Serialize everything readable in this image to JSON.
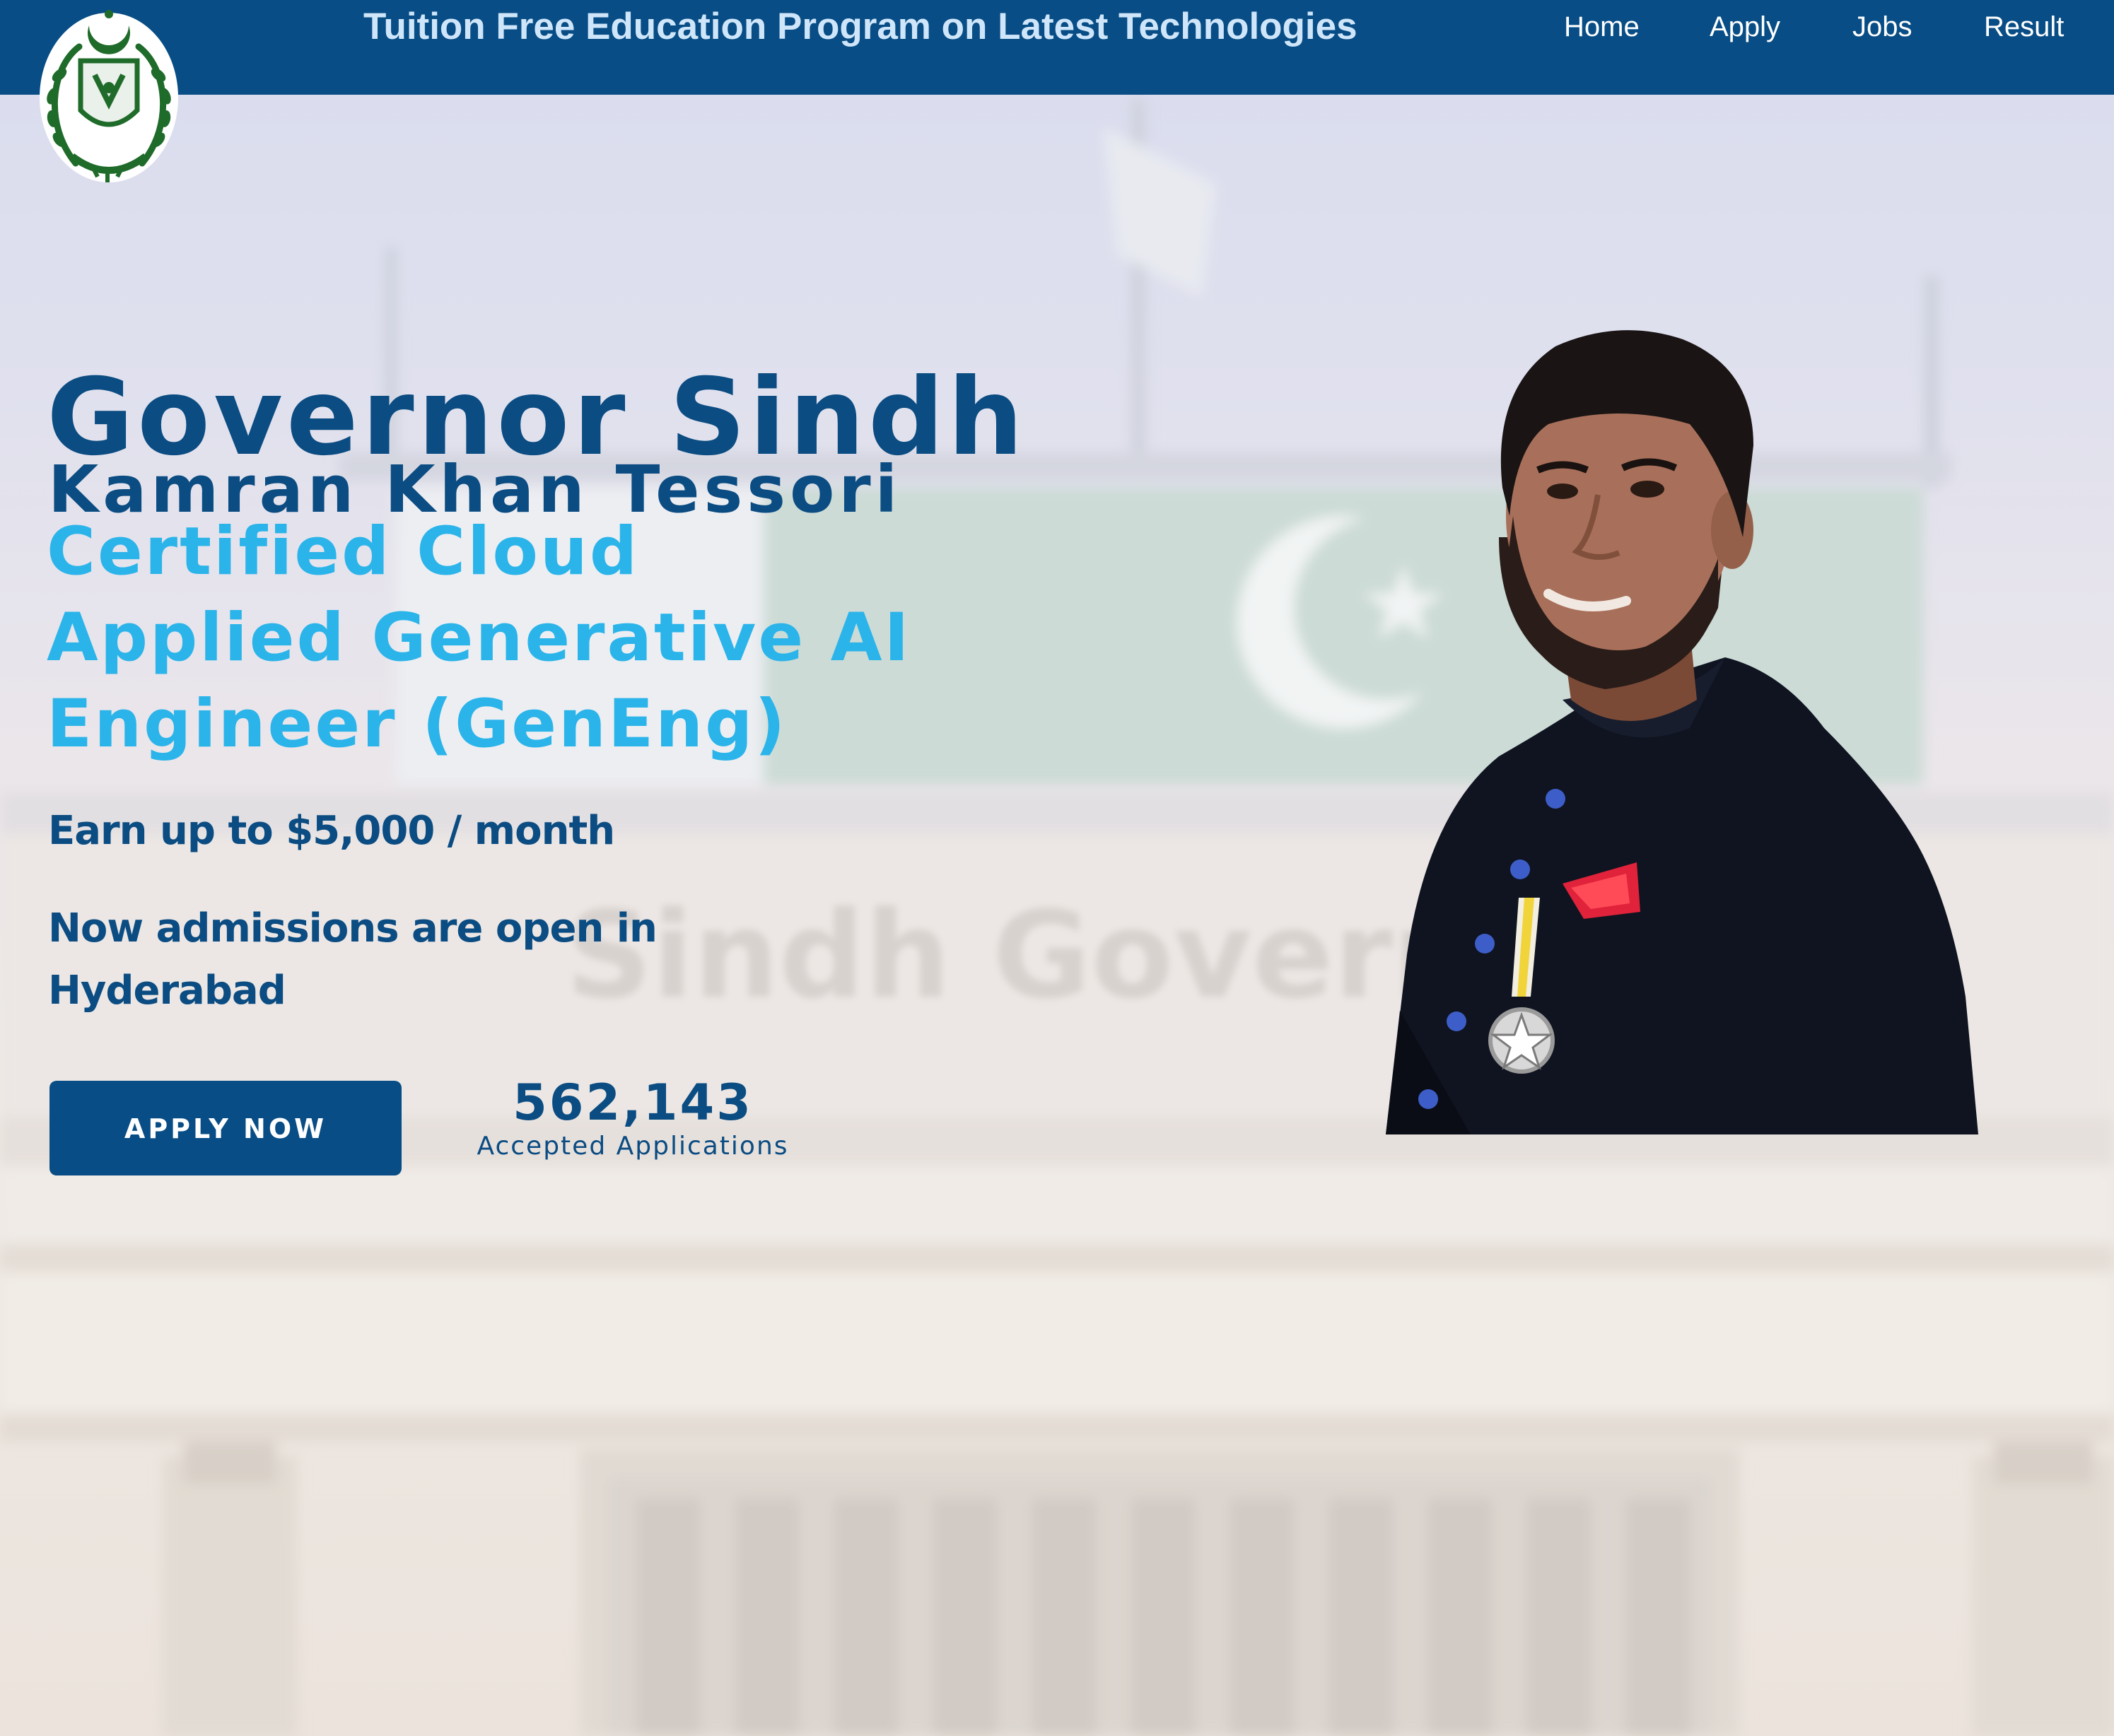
{
  "header": {
    "site_title": "Tuition Free Education Program on Latest Technologies",
    "nav": [
      {
        "label": "Home"
      },
      {
        "label": "Apply"
      },
      {
        "label": "Jobs"
      },
      {
        "label": "Result"
      }
    ]
  },
  "hero": {
    "title": "Governor Sindh",
    "subtitle": "Kamran Khan Tessori",
    "program_lines": [
      "Certified Cloud",
      "Applied Generative AI",
      "Engineer (GenEng)"
    ],
    "earn_text": "Earn up to $5,000 / month",
    "admission_lines": [
      "Now admissions are open in",
      "Hyderabad"
    ],
    "apply_button": "APPLY NOW",
    "stat_value": "562,143",
    "stat_label": "Accepted Applications"
  },
  "background": {
    "building_sign": "Sindh Governor"
  },
  "colors": {
    "header_bg": "#084d85",
    "title_navy": "#0b4c82",
    "accent_cyan": "#2bb4ea",
    "title_text": "#cfe6fa",
    "emblem_green": "#1f6b2a"
  }
}
